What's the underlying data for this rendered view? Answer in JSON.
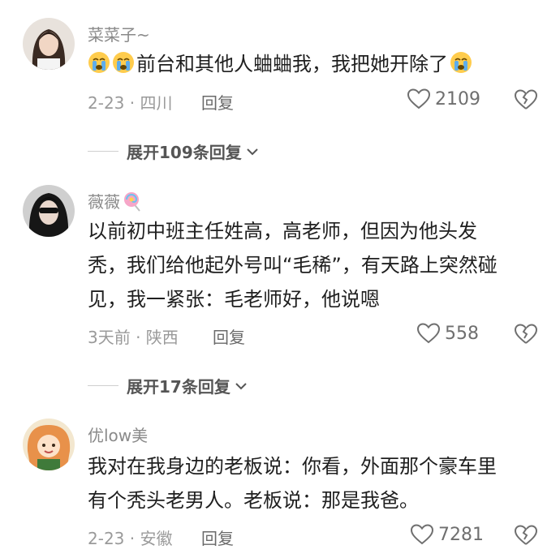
{
  "comments": [
    {
      "username": "菜菜子~",
      "text": "前台和其他人蛐蛐我，我把她开除了",
      "meta": "2-23 · 四川",
      "reply": "回复",
      "likes": "2109",
      "expand": "展开109条回复"
    },
    {
      "username": "薇薇",
      "lines": [
        "以前初中班主任姓高，高老师，但因为他头发",
        "秃，我们给他起外号叫“毛稀”，有天路上突然碰",
        "见，我一紧张：毛老师好，他说嗯"
      ],
      "meta": "3天前 · 陕西",
      "reply": "回复",
      "likes": "558",
      "expand": "展开17条回复"
    },
    {
      "username": "优low美",
      "lines": [
        "我对在我身边的老板说：你看，外面那个豪车里",
        "有个秃头老男人。老板说：那是我爸。"
      ],
      "meta": "2-23 · 安徽",
      "reply": "回复",
      "likes": "7281"
    }
  ],
  "icons": {
    "like": "heart-outline-icon",
    "dislike": "broken-heart-icon",
    "expand": "chevron-down-icon",
    "emoji": "crying-face-emoji",
    "lollipop": "lollipop-emoji"
  }
}
